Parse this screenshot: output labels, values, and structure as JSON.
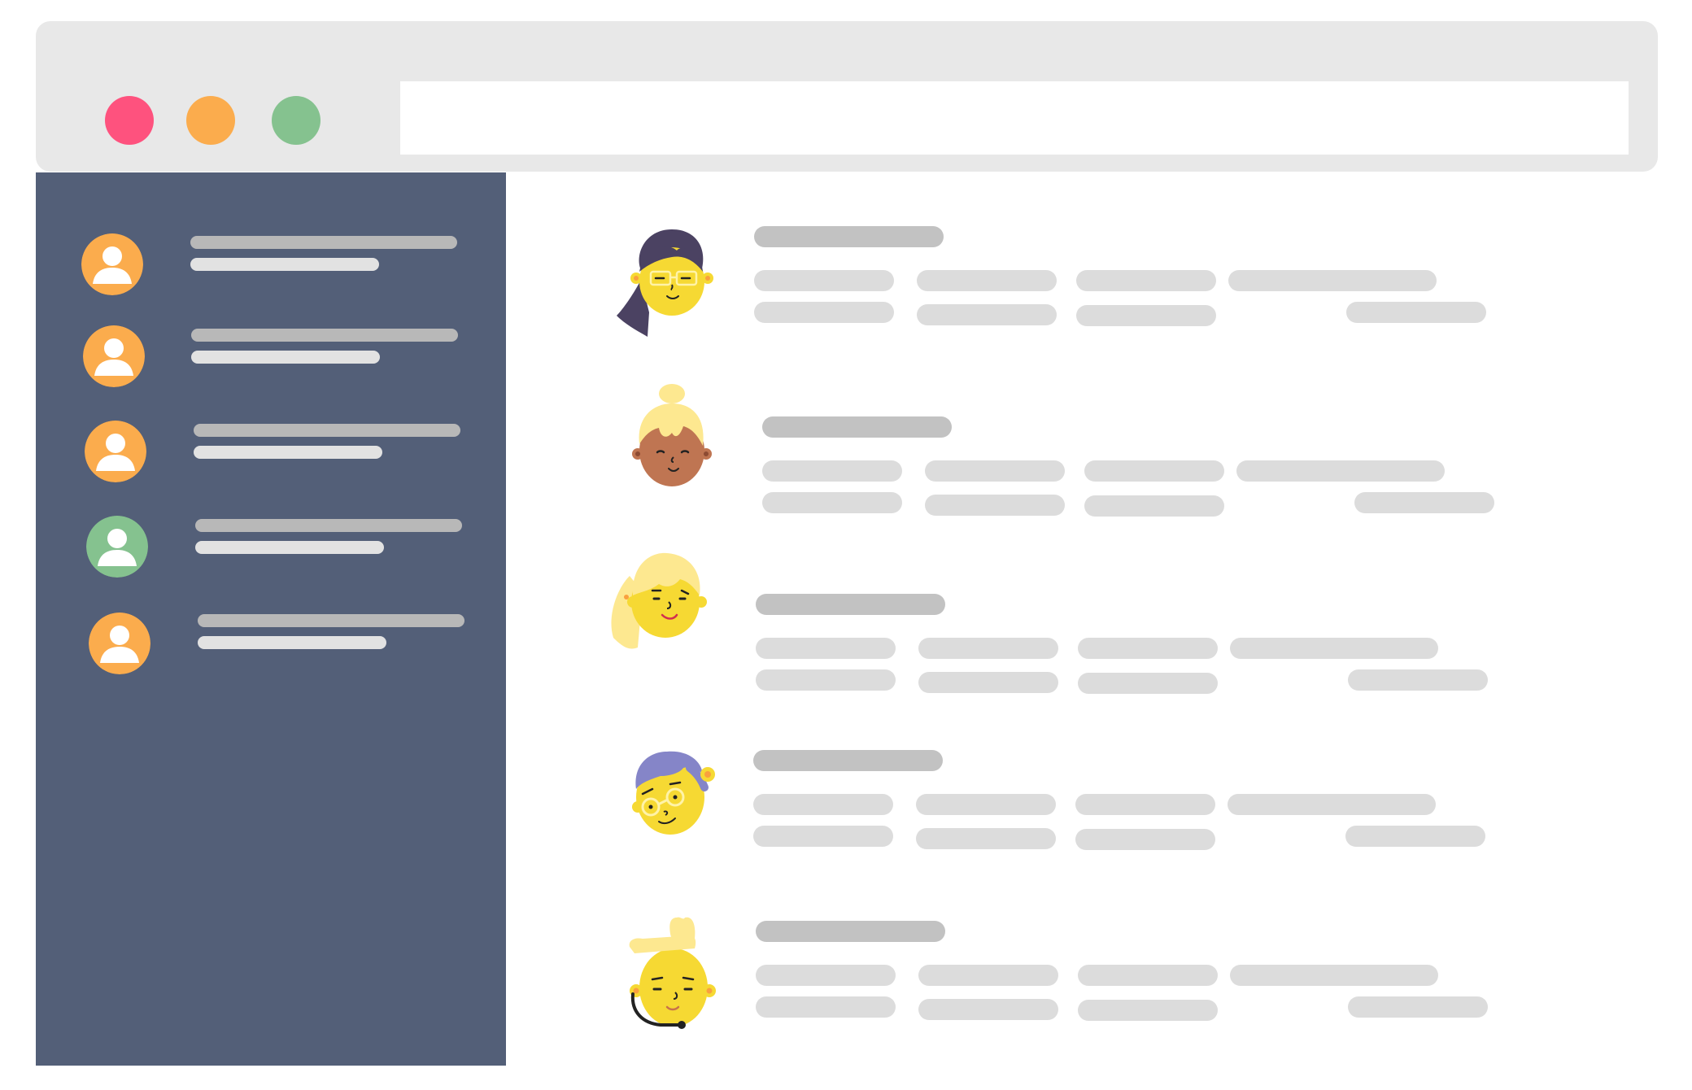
{
  "colors": {
    "frame": "#e8e8e8",
    "address_bar": "#ffffff",
    "close": "#fe527e",
    "minimize": "#fbac4d",
    "maximize": "#85c28f",
    "sidebar": "#535f78",
    "avatar_orange": "#fbac4d",
    "avatar_green": "#85c28f",
    "sidebar_line_primary": "#b8b8b8",
    "sidebar_line_secondary": "#e2e2e2",
    "title_pill": "#c2c2c2",
    "cell_pill": "#dcdcdc",
    "skin_yellow": "#f6d933",
    "skin_brown": "#bf7552"
  },
  "sidebar": {
    "items": [
      {
        "avatar": "user-icon",
        "avatar_color": "orange"
      },
      {
        "avatar": "user-icon",
        "avatar_color": "orange"
      },
      {
        "avatar": "user-icon",
        "avatar_color": "orange"
      },
      {
        "avatar": "user-icon",
        "avatar_color": "green"
      },
      {
        "avatar": "user-icon",
        "avatar_color": "orange"
      }
    ]
  },
  "contacts": [
    {
      "avatar": "woman-glasses-dark-hair-avatar"
    },
    {
      "avatar": "blonde-bun-brown-skin-avatar"
    },
    {
      "avatar": "blonde-long-hair-avatar"
    },
    {
      "avatar": "purple-hair-glasses-avatar"
    },
    {
      "avatar": "headset-support-agent-avatar"
    }
  ]
}
